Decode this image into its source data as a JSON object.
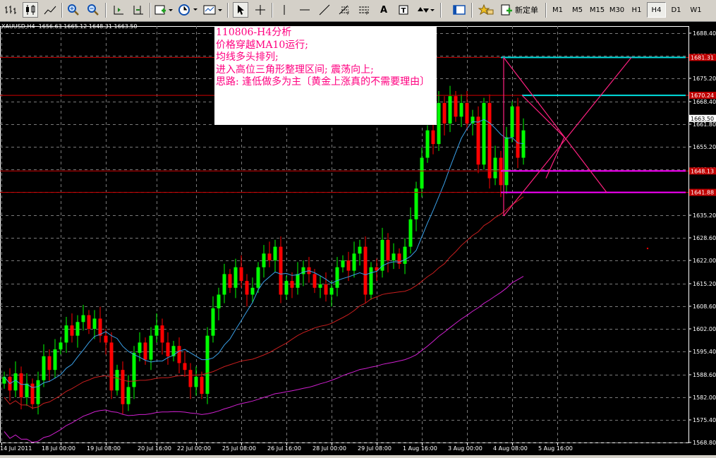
{
  "toolbar": {
    "new_order_label": "新定单",
    "timeframes": [
      "M1",
      "M5",
      "M15",
      "M30",
      "H1",
      "H4",
      "D1",
      "W1"
    ],
    "active_timeframe": "H4",
    "icons": [
      "cursor-icon",
      "crosshair-icon",
      "vertical-line-icon",
      "horizontal-line-icon",
      "trendline-icon",
      "fibonacci-icon",
      "text-icon",
      "label-icon",
      "arrows-icon"
    ]
  },
  "header": {
    "symbol_info": "XAUUSD,H4  1656.63 1665.12 1648.31 1663.50"
  },
  "note": {
    "lines": [
      "110806-H4分析",
      "价格穿越MA10运行;",
      "均线多头排列;",
      "进入高位三角形整理区间; 震荡向上;",
      "思路: 逢低做多为主〔黄金上涨真的不需要理由〕"
    ],
    "color": "#ff0080"
  },
  "chart_data": {
    "type": "candlestick",
    "symbol": "XAUUSD",
    "timeframe": "H4",
    "ohlc_header": {
      "open": 1656.63,
      "high": 1665.12,
      "low": 1648.31,
      "close": 1663.5
    },
    "ylim": [
      1567.5,
      1692
    ],
    "y_ticks": [
      1568.8,
      1575.4,
      1582.0,
      1588.6,
      1595.4,
      1602.0,
      1608.6,
      1615.2,
      1622.0,
      1628.6,
      1635.2,
      1642.0,
      1648.6,
      1655.2,
      1661.8,
      1668.4,
      1675.2,
      1681.8,
      1688.4
    ],
    "x_labels": [
      "14 Jul 2011",
      "18 Jul 00:00",
      "19 Jul 08:00",
      "20 Jul 16:00",
      "22 Jul 00:00",
      "25 Jul 08:00",
      "26 Jul 16:00",
      "28 Jul 00:00",
      "29 Jul 08:00",
      "1 Aug 16:00",
      "3 Aug 00:00",
      "4 Aug 08:00",
      "5 Aug 16:00"
    ],
    "current_price": 1663.5,
    "price_levels": [
      {
        "price": 1681.31,
        "label": "1681.31",
        "color": "#00e0e0"
      },
      {
        "price": 1670.24,
        "label": "1670.24",
        "color": "#00e0e0"
      },
      {
        "price": 1648.13,
        "label": "1648.13",
        "color": "#ff00ff"
      },
      {
        "price": 1641.88,
        "label": "1641.88",
        "color": "#ff00ff"
      }
    ],
    "colors": {
      "bull": "#00ff00",
      "bear": "#ff0000",
      "ma_fast": "#3aa0e8",
      "ma_mid": "#c81e1e",
      "ma_slow": "#d020d0",
      "hline": "#d00000"
    },
    "closes": [
      1588,
      1584,
      1589,
      1582,
      1586,
      1580,
      1587,
      1594,
      1590,
      1596,
      1598,
      1603,
      1600,
      1604,
      1606,
      1602,
      1605,
      1600,
      1598,
      1584,
      1590,
      1580,
      1585,
      1595,
      1598,
      1593,
      1600,
      1603,
      1598,
      1594,
      1597,
      1592,
      1590,
      1585,
      1588,
      1583,
      1600,
      1608,
      1612,
      1618,
      1614,
      1620,
      1616,
      1612,
      1614,
      1620,
      1624,
      1622,
      1626,
      1612,
      1616,
      1614,
      1618,
      1620,
      1618,
      1614,
      1615,
      1612,
      1614,
      1620,
      1622,
      1619,
      1624,
      1626,
      1612,
      1620,
      1619,
      1628,
      1622,
      1624,
      1621,
      1626,
      1634,
      1643,
      1652,
      1660,
      1656,
      1668,
      1662,
      1670,
      1664,
      1668,
      1662,
      1664,
      1650,
      1668,
      1646,
      1652,
      1644,
      1658,
      1667,
      1652,
      1660
    ]
  }
}
